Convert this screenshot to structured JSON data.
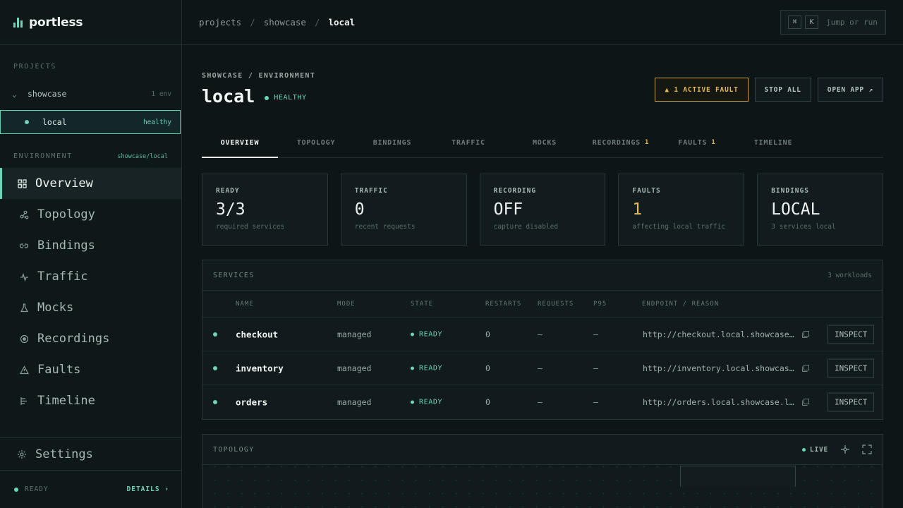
{
  "brand": {
    "name": "portless"
  },
  "sidebar": {
    "projects_label": "PROJECTS",
    "project": {
      "name": "showcase",
      "meta": "1 env"
    },
    "env": {
      "name": "local",
      "status": "healthy"
    },
    "environment_label": "ENVIRONMENT",
    "environment_path": "showcase/local",
    "nav": [
      {
        "label": "Overview",
        "icon": "grid-icon"
      },
      {
        "label": "Topology",
        "icon": "topology-icon"
      },
      {
        "label": "Bindings",
        "icon": "link-icon"
      },
      {
        "label": "Traffic",
        "icon": "pulse-icon"
      },
      {
        "label": "Mocks",
        "icon": "flask-icon"
      },
      {
        "label": "Recordings",
        "icon": "record-icon"
      },
      {
        "label": "Faults",
        "icon": "warning-icon"
      },
      {
        "label": "Timeline",
        "icon": "timeline-icon"
      }
    ],
    "settings": "Settings",
    "footer": {
      "status": "READY",
      "details": "DETAILS ›"
    }
  },
  "topbar": {
    "crumbs": [
      "projects",
      "showcase",
      "local"
    ],
    "cmd_keys": [
      "⌘",
      "K"
    ],
    "cmd_text": "jump or run"
  },
  "header": {
    "eyebrow": "SHOWCASE / ENVIRONMENT",
    "title": "local",
    "health": "HEALTHY",
    "actions": {
      "fault": "▲ 1 ACTIVE FAULT",
      "stop": "STOP ALL",
      "open": "OPEN APP ↗"
    }
  },
  "tabs": [
    {
      "label": "OVERVIEW",
      "badge": ""
    },
    {
      "label": "TOPOLOGY",
      "badge": ""
    },
    {
      "label": "BINDINGS",
      "badge": ""
    },
    {
      "label": "TRAFFIC",
      "badge": ""
    },
    {
      "label": "MOCKS",
      "badge": ""
    },
    {
      "label": "RECORDINGS",
      "badge": "1"
    },
    {
      "label": "FAULTS",
      "badge": "1"
    },
    {
      "label": "TIMELINE",
      "badge": ""
    }
  ],
  "stats": [
    {
      "label": "READY",
      "value": "3/3",
      "sub": "required services"
    },
    {
      "label": "TRAFFIC",
      "value": "0",
      "sub": "recent requests"
    },
    {
      "label": "RECORDING",
      "value": "OFF",
      "sub": "capture disabled"
    },
    {
      "label": "FAULTS",
      "value": "1",
      "sub": "affecting local traffic"
    },
    {
      "label": "BINDINGS",
      "value": "LOCAL",
      "sub": "3 services local"
    }
  ],
  "services": {
    "title": "SERVICES",
    "count": "3 workloads",
    "columns": [
      "NAME",
      "MODE",
      "STATE",
      "RESTARTS",
      "REQUESTS",
      "P95",
      "ENDPOINT / REASON"
    ],
    "rows": [
      {
        "name": "checkout",
        "mode": "managed",
        "state": "READY",
        "restarts": "0",
        "requests": "—",
        "p95": "—",
        "endpoint": "http://checkout.local.showcase.localhost",
        "action": "INSPECT"
      },
      {
        "name": "inventory",
        "mode": "managed",
        "state": "READY",
        "restarts": "0",
        "requests": "—",
        "p95": "—",
        "endpoint": "http://inventory.local.showcase.localhost",
        "action": "INSPECT"
      },
      {
        "name": "orders",
        "mode": "managed",
        "state": "READY",
        "restarts": "0",
        "requests": "—",
        "p95": "—",
        "endpoint": "http://orders.local.showcase.localhost",
        "action": "INSPECT"
      }
    ]
  },
  "topology": {
    "title": "TOPOLOGY",
    "live": "LIVE"
  },
  "colors": {
    "accent": "#6fd3b6",
    "warning": "#e2b85a",
    "background": "#0e1517"
  }
}
